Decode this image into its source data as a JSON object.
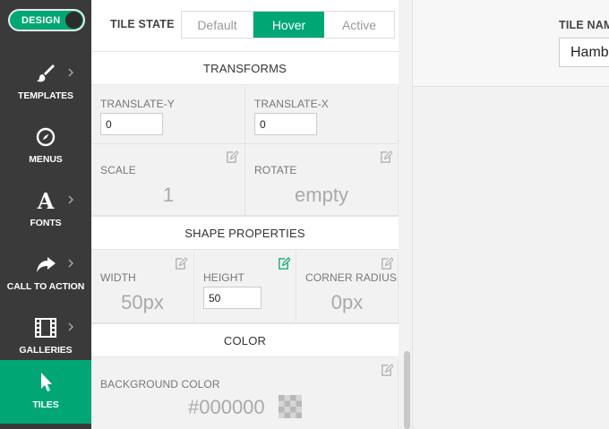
{
  "sidebar": {
    "toggle_label": "DESIGN",
    "items": [
      {
        "label": "TEMPLATES",
        "icon": "brush-icon"
      },
      {
        "label": "MENUS",
        "icon": "compass-icon"
      },
      {
        "label": "FONTS",
        "icon": "font-icon"
      },
      {
        "label": "CALL TO ACTION",
        "icon": "share-arrow-icon"
      },
      {
        "label": "GALLERIES",
        "icon": "film-icon"
      },
      {
        "label": "TILES",
        "icon": "cursor-icon"
      }
    ]
  },
  "tile_state": {
    "label": "TILE STATE",
    "tabs": [
      "Default",
      "Hover",
      "Active"
    ],
    "selected": "Hover"
  },
  "sections": {
    "transforms": "TRANSFORMS",
    "shape": "SHAPE PROPERTIES",
    "color": "COLOR"
  },
  "fields": {
    "translate_y": {
      "label": "TRANSLATE-Y",
      "value": "0"
    },
    "translate_x": {
      "label": "TRANSLATE-X",
      "value": "0"
    },
    "scale": {
      "label": "SCALE",
      "value": "1"
    },
    "rotate": {
      "label": "ROTATE",
      "value": "empty"
    },
    "width": {
      "label": "WIDTH",
      "value": "50px"
    },
    "height": {
      "label": "HEIGHT",
      "value": "50"
    },
    "corner_radius": {
      "label": "CORNER RADIUS",
      "value": "0px"
    },
    "background_color": {
      "label": "BACKGROUND COLOR",
      "value": "#000000"
    }
  },
  "tile_name": {
    "label": "TILE NAME",
    "value": "Hamburger"
  },
  "colors": {
    "accent": "#00a774",
    "sidebar": "#3a3a3a"
  }
}
